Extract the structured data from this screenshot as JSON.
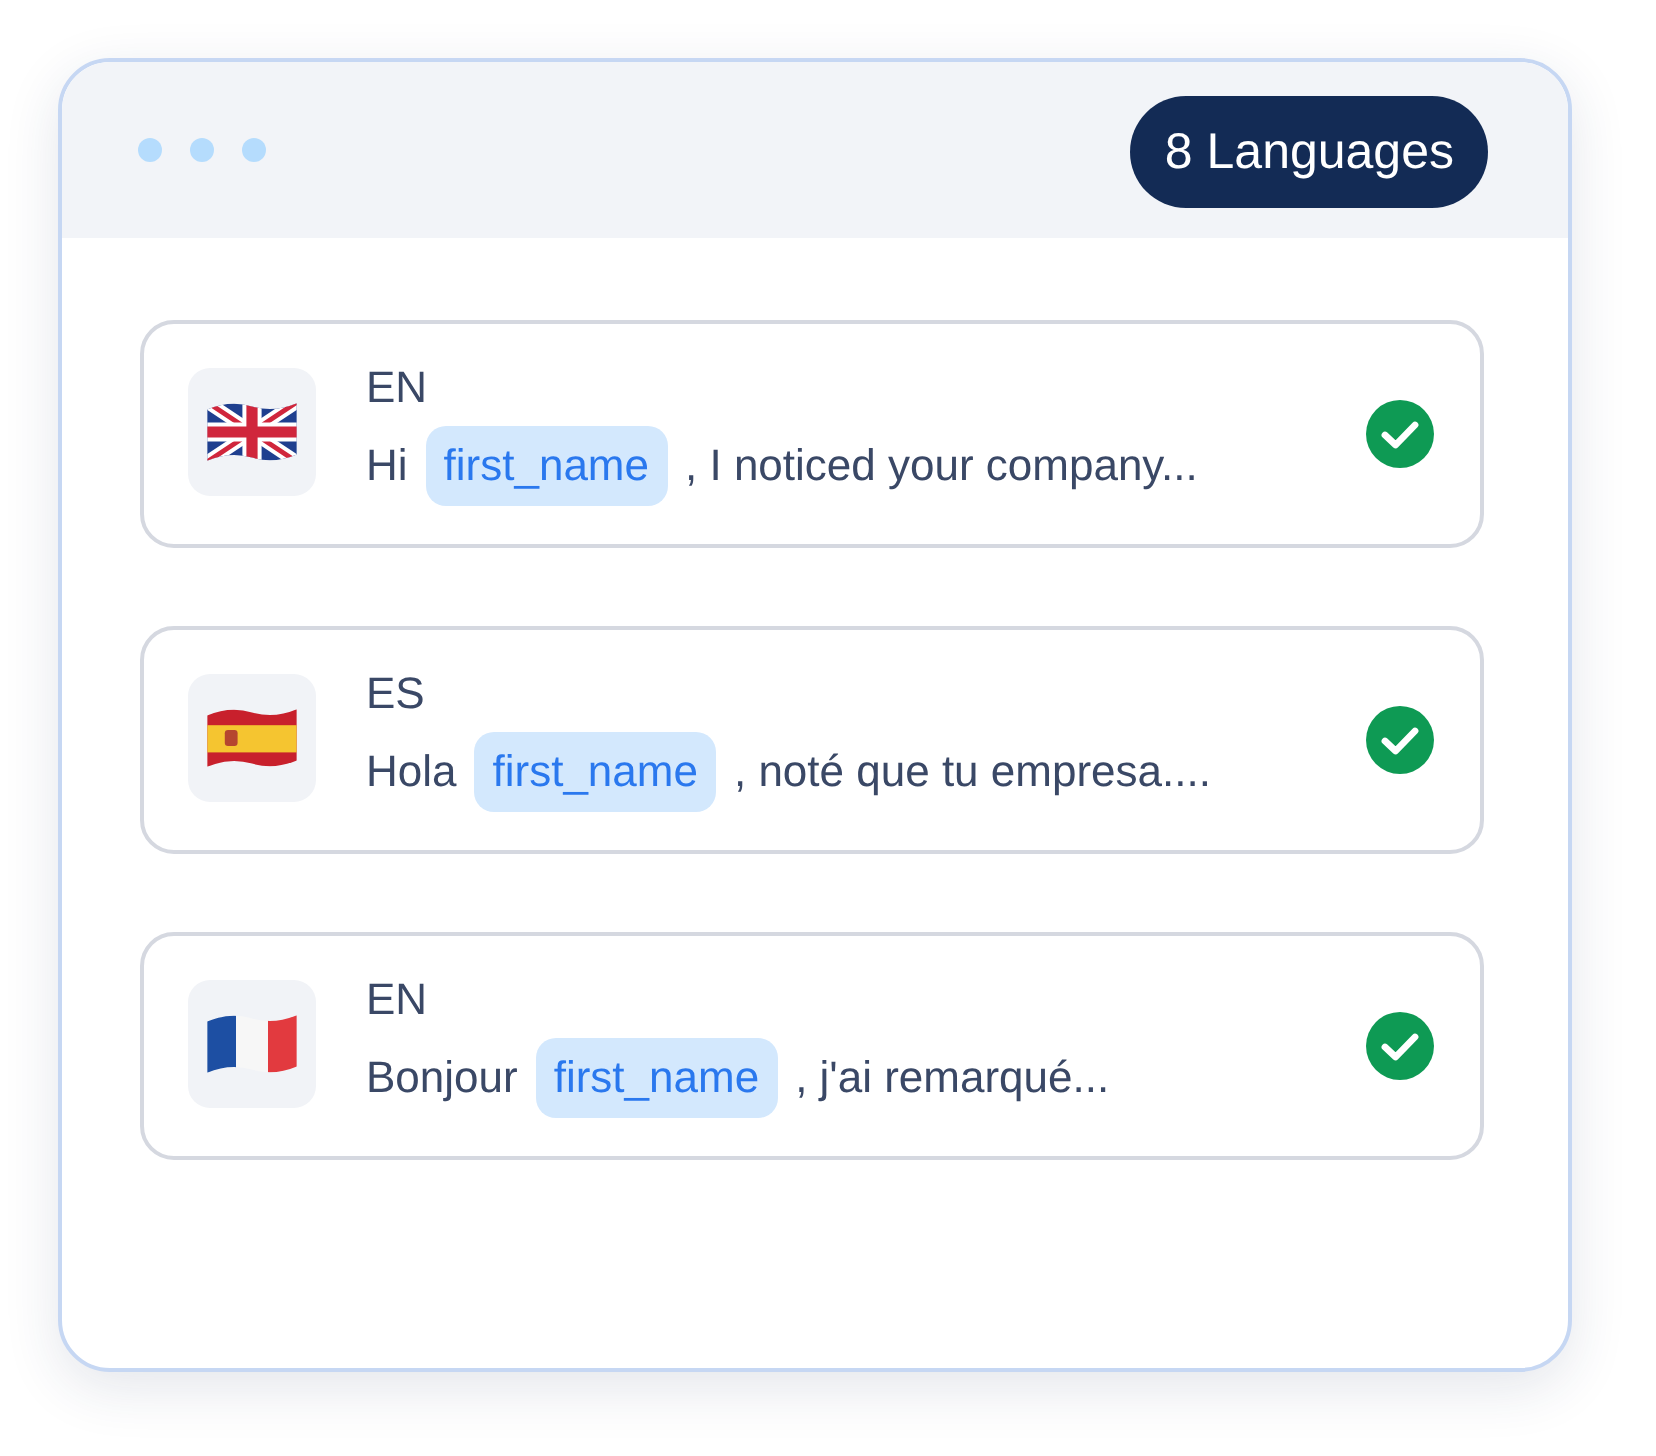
{
  "header": {
    "badge": "8 Languages"
  },
  "translations": [
    {
      "kind": "uk",
      "language": "EN",
      "greeting": "Hi",
      "token": "first_name",
      "message": ", I noticed your company...",
      "approved": true
    },
    {
      "kind": "spain",
      "language": "ES",
      "greeting": "Hola",
      "token": "first_name",
      "message": ", noté que tu empresa....",
      "approved": true
    },
    {
      "kind": "france",
      "language": "EN",
      "greeting": "Bonjour",
      "token": "first_name",
      "message": ", j'ai remarqué...",
      "approved": true
    }
  ]
}
